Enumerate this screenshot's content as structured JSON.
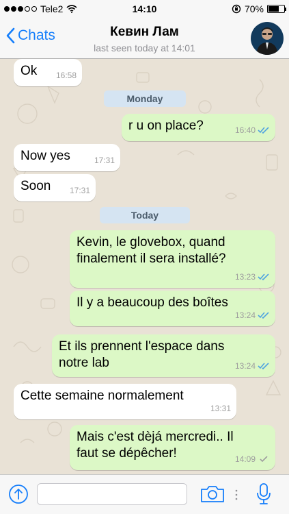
{
  "status_bar": {
    "carrier": "Tele2",
    "time": "14:10",
    "battery": "70%",
    "battery_level": 0.7,
    "signal_dots_filled": 3,
    "signal_dots_total": 5
  },
  "header": {
    "back_label": "Chats",
    "contact_name": "Кевин Лам",
    "last_seen": "last seen today at 14:01",
    "accent_color": "#157efb"
  },
  "messages": [
    {
      "side": "in",
      "text": "Ok",
      "time": "16:58"
    },
    {
      "day": "Monday"
    },
    {
      "side": "out",
      "text": "r u on place?",
      "time": "16:40",
      "status": "read"
    },
    {
      "side": "in",
      "text": "Now yes",
      "time": "17:31"
    },
    {
      "side": "in",
      "text": "Soon",
      "time": "17:31"
    },
    {
      "day": "Today"
    },
    {
      "side": "out",
      "text_lines": [
        "Kevin, le glovebox, quand",
        "finalement il sera installé?"
      ],
      "time": "13:23",
      "status": "read"
    },
    {
      "side": "out",
      "text": "Il y a beaucoup des boîtes",
      "time": "13:24",
      "status": "read"
    },
    {
      "side": "out",
      "text_lines": [
        "Et ils prennent l'espace dans",
        "notre lab"
      ],
      "time": "13:24",
      "status": "read"
    },
    {
      "side": "in",
      "text": "Cette semaine normalement",
      "time": "13:31"
    },
    {
      "side": "out",
      "text_lines": [
        "Mais c'est dèjá mercredi.. Il",
        "faut se dépêcher!"
      ],
      "time": "14:09",
      "status": "delivered"
    }
  ],
  "input_bar": {
    "message_value": "",
    "icons": [
      "share-icon",
      "camera-icon",
      "microphone-icon"
    ]
  },
  "colors": {
    "incoming_bubble": "#ffffff",
    "outgoing_bubble": "#dcf8c6",
    "read_ticks": "#4fa3e0",
    "delivered_tick": "#9e9e9e",
    "day_chip": "#d5e4f2"
  }
}
